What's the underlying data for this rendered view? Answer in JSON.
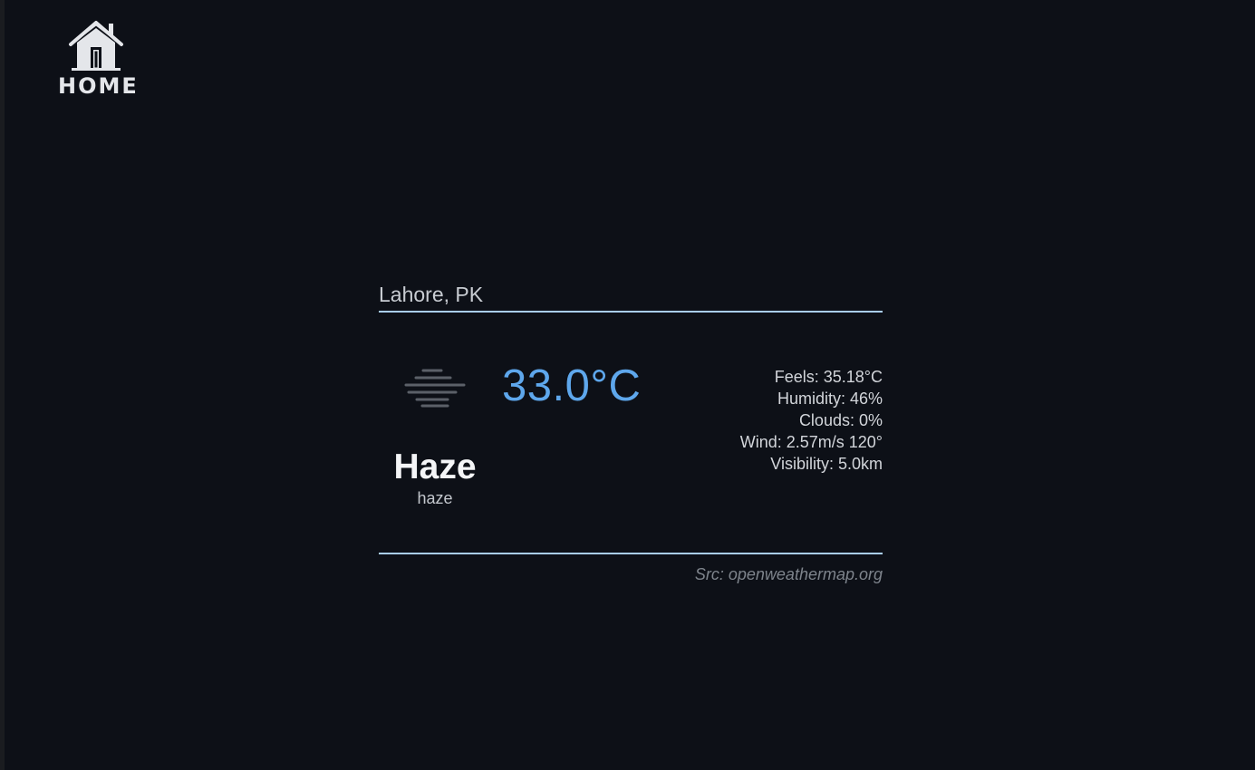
{
  "nav": {
    "home_label": "HOME",
    "home_icon": "house-icon"
  },
  "weather": {
    "location": "Lahore, PK",
    "temperature": "33.0°C",
    "condition_icon": "haze-icon",
    "condition": "Haze",
    "description": "haze",
    "stats": {
      "feels": "Feels: 35.18°C",
      "humidity": "Humidity: 46%",
      "clouds": "Clouds: 0%",
      "wind": "Wind: 2.57m/s 120°",
      "visibility": "Visibility: 5.0km"
    },
    "source": "Src: openweathermap.org"
  },
  "colors": {
    "background": "#0d1017",
    "accent_temperature": "#5ea7ec",
    "divider": "#a9cdf2"
  }
}
